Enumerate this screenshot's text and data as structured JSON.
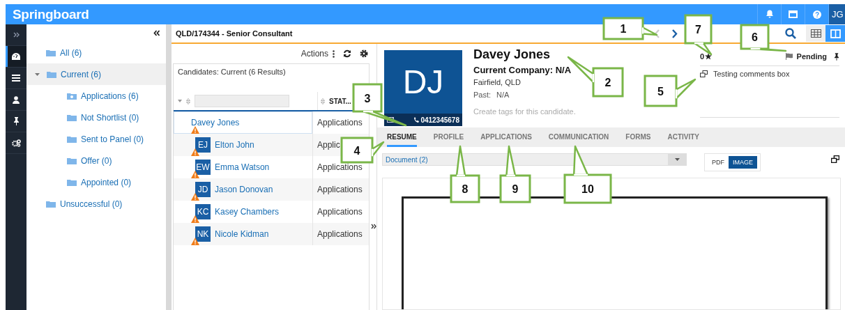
{
  "app": {
    "logo": "Springboard",
    "user_initials": "JG"
  },
  "rail": [
    {
      "kind": "dashboard",
      "selected": true
    },
    {
      "kind": "list",
      "selected": false
    },
    {
      "kind": "person",
      "selected": false
    },
    {
      "kind": "pin",
      "selected": false
    },
    {
      "kind": "cogs",
      "selected": false
    }
  ],
  "tree": [
    {
      "label": "All (6)",
      "kind": "folder",
      "selected": false
    },
    {
      "label": "Current (6)",
      "kind": "folder",
      "selected": true,
      "expanded": true,
      "children": [
        {
          "label": "Applications (6)",
          "kind": "inbox",
          "selected": false
        },
        {
          "label": "Not Shortlist (0)",
          "kind": "folder",
          "selected": false
        },
        {
          "label": "Sent to Panel (0)",
          "kind": "folder",
          "selected": false
        },
        {
          "label": "Offer (0)",
          "kind": "folder",
          "selected": false
        },
        {
          "label": "Appointed (0)",
          "kind": "folder",
          "selected": false
        }
      ]
    },
    {
      "label": "Unsuccessful (0)",
      "kind": "folder",
      "selected": false
    }
  ],
  "job_title": "QLD/174344 - Senior Consultant",
  "candidates": {
    "actions_label": "Actions",
    "title": "Candidates: Current (6 Results)",
    "status_header": "STAT...",
    "rows": [
      {
        "name": "Davey Jones",
        "status": "Applications",
        "warning": true,
        "selected": true
      },
      {
        "name": "Elton John",
        "initials": "EJ",
        "status": "Applic",
        "warning": true,
        "selected": false
      },
      {
        "name": "Emma Watson",
        "initials": "EW",
        "status": "Applications",
        "warning": true,
        "selected": false
      },
      {
        "name": "Jason Donovan",
        "initials": "JD",
        "status": "Applications",
        "warning": true,
        "selected": false
      },
      {
        "name": "Kasey Chambers",
        "initials": "KC",
        "status": "Applications",
        "warning": true,
        "selected": false
      },
      {
        "name": "Nicole Kidman",
        "initials": "NK",
        "status": "Applications",
        "warning": true,
        "selected": false
      }
    ]
  },
  "profile": {
    "initials": "DJ",
    "phone": "0412345678",
    "name": "Davey Jones",
    "company": "Current Company: N/A",
    "location": "Fairfield, QLD",
    "past_label": "Past:",
    "past_value": "N/A",
    "tags_placeholder": "Create tags for this candidate.",
    "rating": "0",
    "status": "Pending",
    "comment": "Testing comments box"
  },
  "tabs": [
    {
      "label": "RESUME",
      "selected": true
    },
    {
      "label": "PROFILE",
      "selected": false
    },
    {
      "label": "APPLICATIONS",
      "selected": false
    },
    {
      "label": "COMMUNICATION",
      "selected": false
    },
    {
      "label": "FORMS",
      "selected": false
    },
    {
      "label": "ACTIVITY",
      "selected": false
    }
  ],
  "document_select": "Document (2)",
  "view_toggle": [
    {
      "label": "PDF",
      "selected": false
    },
    {
      "label": "IMAGE",
      "selected": true
    }
  ],
  "callouts": [
    "1",
    "2",
    "3",
    "4",
    "5",
    "6",
    "7",
    "8",
    "9",
    "10"
  ]
}
